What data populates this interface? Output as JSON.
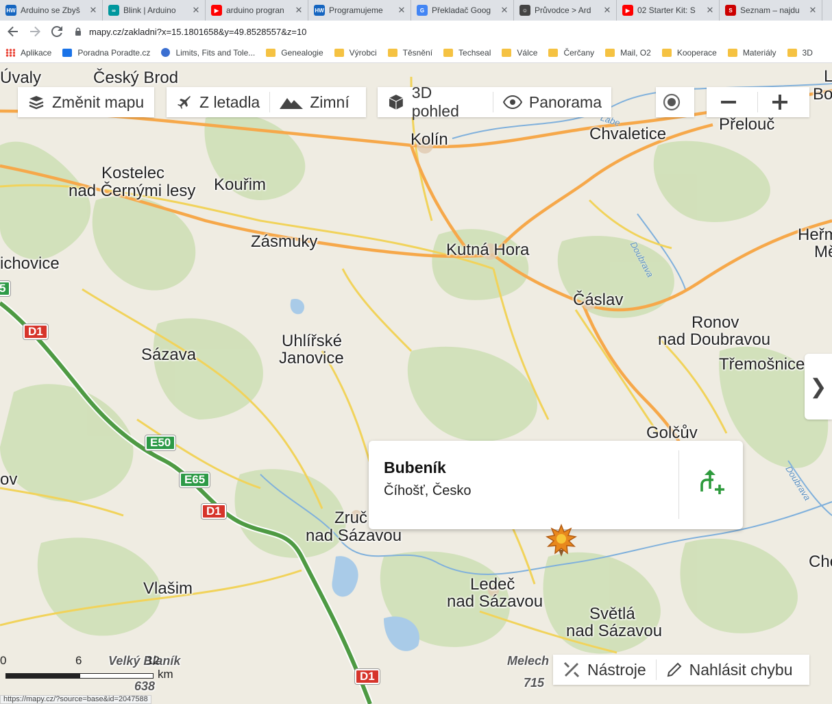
{
  "tabs": [
    {
      "title": "Arduino se Zbyš",
      "icon": "hw",
      "color": "#1565c0"
    },
    {
      "title": "Blink | Arduino",
      "icon": "arduino",
      "color": "#00979d"
    },
    {
      "title": "arduino progran",
      "icon": "youtube",
      "color": "#ff0000"
    },
    {
      "title": "Programujeme",
      "icon": "hw",
      "color": "#1565c0"
    },
    {
      "title": "Překladač Goog",
      "icon": "translate",
      "color": "#4285f4"
    },
    {
      "title": "Průvodce > Ard",
      "icon": "robot",
      "color": "#444444"
    },
    {
      "title": "02 Starter Kit: S",
      "icon": "youtube",
      "color": "#ff0000"
    },
    {
      "title": "Seznam – najdu",
      "icon": "seznam",
      "color": "#cc0000"
    }
  ],
  "toolbar": {
    "url": "mapy.cz/zakladni?x=15.1801658&y=49.8528557&z=10"
  },
  "bookmarks": [
    {
      "label": "Aplikace",
      "type": "apps"
    },
    {
      "label": "Poradna Poradte.cz",
      "type": "check"
    },
    {
      "label": "Limits, Fits and Tole...",
      "type": "globe"
    },
    {
      "label": "Genealogie",
      "type": "folder"
    },
    {
      "label": "Výrobci",
      "type": "folder"
    },
    {
      "label": "Těsnění",
      "type": "folder"
    },
    {
      "label": "Techseal",
      "type": "folder"
    },
    {
      "label": "Válce",
      "type": "folder"
    },
    {
      "label": "Čerčany",
      "type": "folder"
    },
    {
      "label": "Mail, O2",
      "type": "folder"
    },
    {
      "label": "Kooperace",
      "type": "folder"
    },
    {
      "label": "Materiály",
      "type": "folder"
    },
    {
      "label": "3D",
      "type": "folder"
    }
  ],
  "map_controls": {
    "change_map": "Změnit mapu",
    "aerial": "Z letadla",
    "winter": "Zimní",
    "view_3d": "3D pohled",
    "panorama": "Panorama",
    "tools": "Nástroje",
    "report_error": "Nahlásit chybu"
  },
  "places": {
    "uvaly": "Úvaly",
    "cesky_brod": "Český Brod",
    "kolin": "Kolín",
    "chvaletice": "Chvaletice",
    "prelouc": "Přelouč",
    "kostelec1": "Kostelec",
    "kostelec2": "nad Černými lesy",
    "kourim": "Kouřim",
    "zasmuky": "Zásmuky",
    "kutna_hora": "Kutná Hora",
    "hermanuv1": "Heřm",
    "hermanuv2": "Mě",
    "ichovice": "ichovice",
    "caslav": "Čáslav",
    "ronov1": "Ronov",
    "ronov2": "nad Doubravou",
    "tremosnice": "Třemošnice",
    "uhlirske1": "Uhlířské",
    "uhlirske2": "Janovice",
    "sazava": "Sázava",
    "golcuv": "Golčův",
    "ov": "ov",
    "zruc1": "Zruč",
    "zruc2": "nad Sázavou",
    "vlasim": "Vlašim",
    "ledec1": "Ledeč",
    "ledec2": "nad Sázavou",
    "svetla1": "Světlá",
    "svetla2": "nad Sázavou",
    "che": "Che",
    "bo": "Bo",
    "l": "L",
    "melechov": "Melech",
    "velky_blanik": "Velký Blaník",
    "e638": "638",
    "e715": "715",
    "doubrava1": "Doubrava",
    "doubrava2": "Doubrava",
    "labe": "Labe"
  },
  "roads": {
    "d1_a": "D1",
    "d1_b": "D1",
    "d1_c": "D1",
    "e50": "E50",
    "e65": "E65",
    "e5": "5"
  },
  "popup": {
    "name": "Bubeník",
    "location": "Číhošť, Česko"
  },
  "scale": {
    "zero": "0",
    "six": "6",
    "twelve": "12",
    "unit": "km"
  },
  "status_bar": {
    "url": "https://mapy.cz/?source=base&id=2047588"
  },
  "colors": {
    "main_road": "#f6a84a",
    "minor_road": "#f2d25a",
    "forest": "#c9dcb0",
    "motorway": "#3e8f3e",
    "water": "#9cc3e6"
  }
}
